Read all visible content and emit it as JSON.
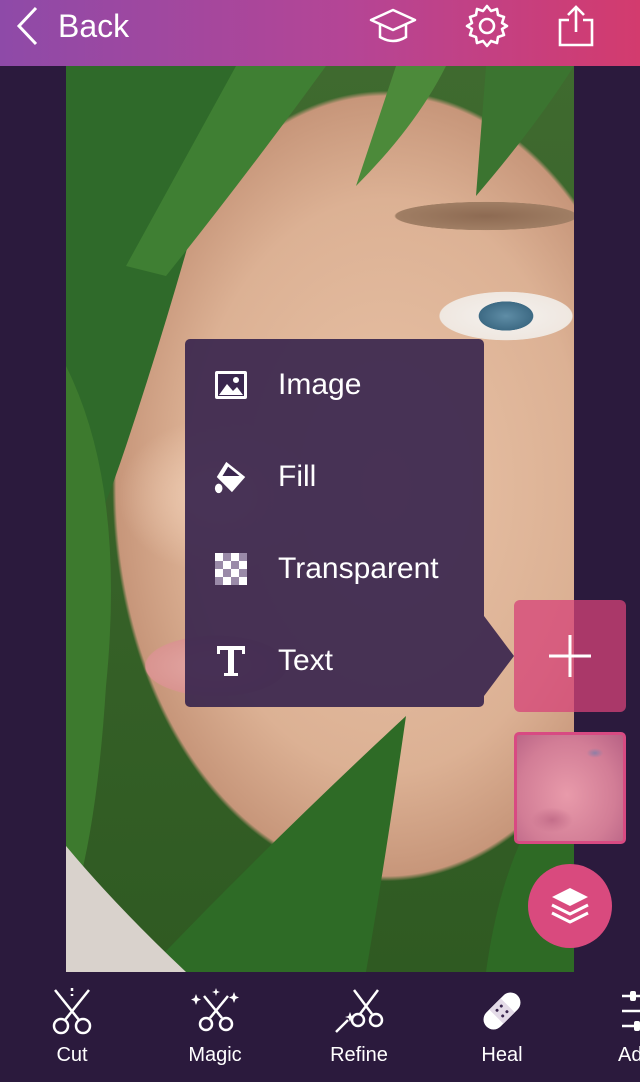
{
  "header": {
    "back_label": "Back",
    "icons": [
      "graduation-cap-icon",
      "gear-icon",
      "share-icon"
    ]
  },
  "add_menu": {
    "items": [
      {
        "label": "Image",
        "icon": "image-icon"
      },
      {
        "label": "Fill",
        "icon": "paint-bucket-icon"
      },
      {
        "label": "Transparent",
        "icon": "checkerboard-icon"
      },
      {
        "label": "Text",
        "icon": "text-t-icon"
      }
    ]
  },
  "side_panel": {
    "add_icon": "plus-icon",
    "layers_icon": "layers-icon"
  },
  "toolbar": {
    "tools": [
      {
        "label": "Cut",
        "icon": "scissors-icon"
      },
      {
        "label": "Magic",
        "icon": "magic-scissors-icon"
      },
      {
        "label": "Refine",
        "icon": "wand-scissors-icon"
      },
      {
        "label": "Heal",
        "icon": "bandage-icon"
      },
      {
        "label": "Ad",
        "icon": "sliders-icon"
      }
    ]
  },
  "colors": {
    "header_gradient_start": "#8e4aa8",
    "header_gradient_end": "#d33b6e",
    "background": "#2b1a3d",
    "accent": "#d94a7e"
  }
}
